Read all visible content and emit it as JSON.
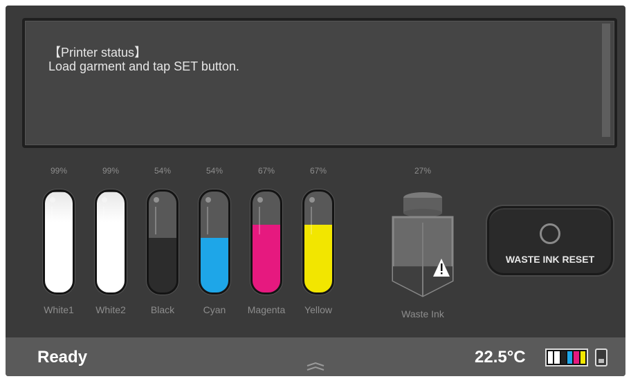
{
  "status": {
    "title": "【Printer status】",
    "message": "Load garment and tap SET button."
  },
  "inks": [
    {
      "name": "White1",
      "percent_label": "99%",
      "level": 0.99,
      "color": "#ffffff"
    },
    {
      "name": "White2",
      "percent_label": "99%",
      "level": 0.99,
      "color": "#ffffff"
    },
    {
      "name": "Black",
      "percent_label": "54%",
      "level": 0.54,
      "color": "#2c2c2c"
    },
    {
      "name": "Cyan",
      "percent_label": "54%",
      "level": 0.54,
      "color": "#1ea6e8"
    },
    {
      "name": "Magenta",
      "percent_label": "67%",
      "level": 0.67,
      "color": "#e6197f"
    },
    {
      "name": "Yellow",
      "percent_label": "67%",
      "level": 0.67,
      "color": "#f2e600"
    }
  ],
  "waste_ink": {
    "name": "Waste Ink",
    "percent_label": "27%",
    "level": 0.27
  },
  "waste_reset_button": {
    "label": "WASTE INK RESET"
  },
  "footer": {
    "status": "Ready",
    "temperature": "22.5°C",
    "ink_icon_colors": [
      "#ffffff",
      "#ffffff",
      "#222222",
      "#1ea6e8",
      "#e6197f",
      "#f2e600"
    ]
  }
}
